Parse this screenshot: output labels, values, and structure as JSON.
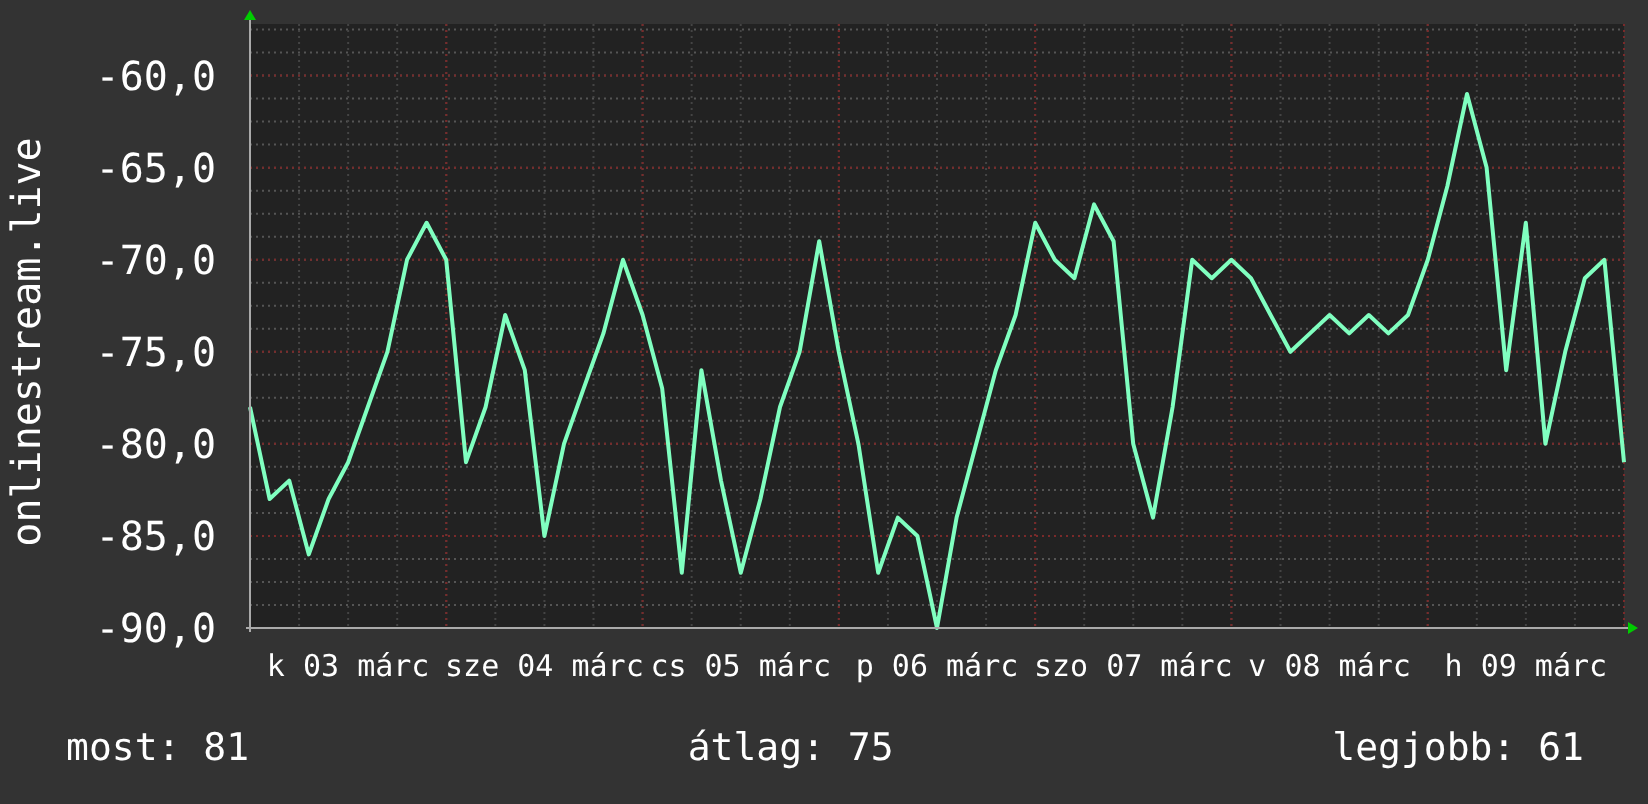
{
  "graph": {
    "chart_data": {
      "type": "line",
      "ylabel": "onlinestream.live",
      "grid": true,
      "ylim": [
        -90,
        -57.2
      ],
      "yticks": [
        {
          "value": -60,
          "label": "-60,0"
        },
        {
          "value": -65,
          "label": "-65,0"
        },
        {
          "value": -70,
          "label": "-70,0"
        },
        {
          "value": -75,
          "label": "-75,0"
        },
        {
          "value": -80,
          "label": "-80,0"
        },
        {
          "value": -85,
          "label": "-85,0"
        },
        {
          "value": -90,
          "label": "-90,0"
        }
      ],
      "categories": [
        null,
        null,
        null,
        null,
        null,
        "k 03 márc",
        null,
        null,
        null,
        null,
        null,
        null,
        null,
        null,
        null,
        "sze 04 márc",
        null,
        null,
        null,
        null,
        null,
        null,
        null,
        null,
        null,
        "cs 05 márc",
        null,
        null,
        null,
        null,
        null,
        null,
        null,
        null,
        null,
        "p 06 márc",
        null,
        null,
        null,
        null,
        null,
        null,
        null,
        null,
        null,
        "szo 07 márc",
        null,
        null,
        null,
        null,
        null,
        null,
        null,
        null,
        null,
        "v 08 márc",
        null,
        null,
        null,
        null,
        null,
        null,
        null,
        null,
        null,
        "h 09 márc",
        null,
        null,
        null,
        null,
        null
      ],
      "series": [
        {
          "color": "#80ffc0",
          "values": [
            -78,
            -83,
            -82,
            -86,
            -83,
            -81,
            -78,
            -75,
            -70,
            -68,
            -70,
            -81,
            -78,
            -73,
            -76,
            -85,
            -80,
            -77,
            -74,
            -70,
            -73,
            -77,
            -87,
            -76,
            -82,
            -87,
            -83,
            -78,
            -75,
            -69,
            -75,
            -80,
            -87,
            -84,
            -85,
            -90,
            -84,
            -80,
            -76,
            -73,
            -68,
            -70,
            -71,
            -67,
            -69,
            -80,
            -84,
            -78,
            -70,
            -71,
            -70,
            -71,
            -73,
            -75,
            -74,
            -73,
            -74,
            -73,
            -74,
            -73,
            -70,
            -66,
            -61,
            -65,
            -76,
            -68,
            -80,
            -75,
            -71,
            -70,
            -81
          ]
        }
      ]
    }
  },
  "legend": [
    {
      "text": "most: 81"
    },
    {
      "text": "átlag: 75"
    },
    {
      "text": "legjobb: 61"
    }
  ]
}
